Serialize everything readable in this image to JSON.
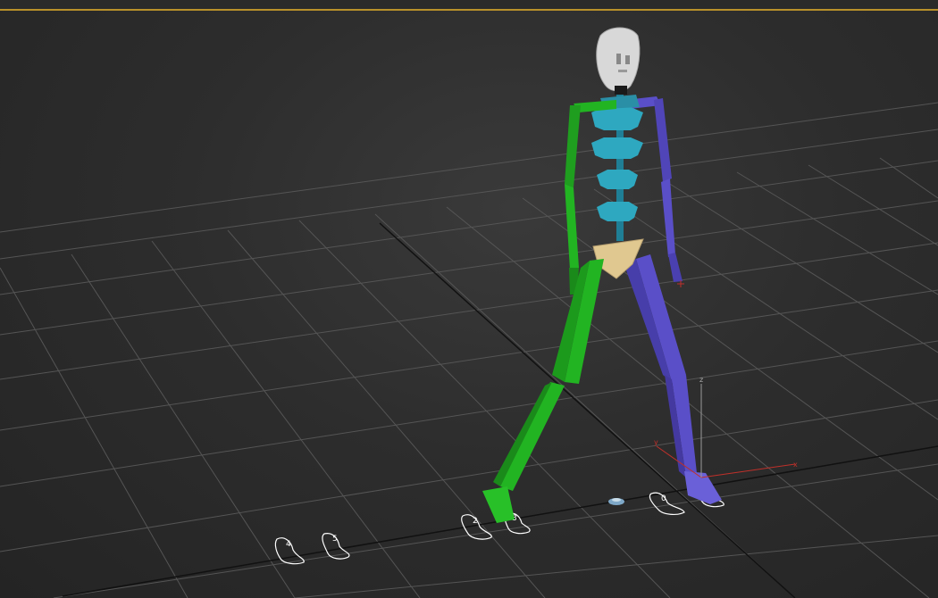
{
  "viewport": {
    "frame_color": "#b8902a",
    "background": "#2d2d2d",
    "grid_color": "#5a5a5a"
  },
  "gizmo": {
    "x_label": "x",
    "y_label": "y",
    "z_label": "z",
    "x_color": "#c0302a",
    "y_color": "#c0302a",
    "z_color": "#9a9a9a"
  },
  "biped": {
    "left_color": "#22b422",
    "right_color": "#5a4fc8",
    "spine_color": "#2ea8c0",
    "pelvis_color": "#e0c890",
    "head_color": "#d8d8d8"
  },
  "footsteps": [
    {
      "label": "4"
    },
    {
      "label": "5"
    },
    {
      "label": "2"
    },
    {
      "label": "3"
    },
    {
      "label": "0"
    },
    {
      "label": "1"
    }
  ]
}
